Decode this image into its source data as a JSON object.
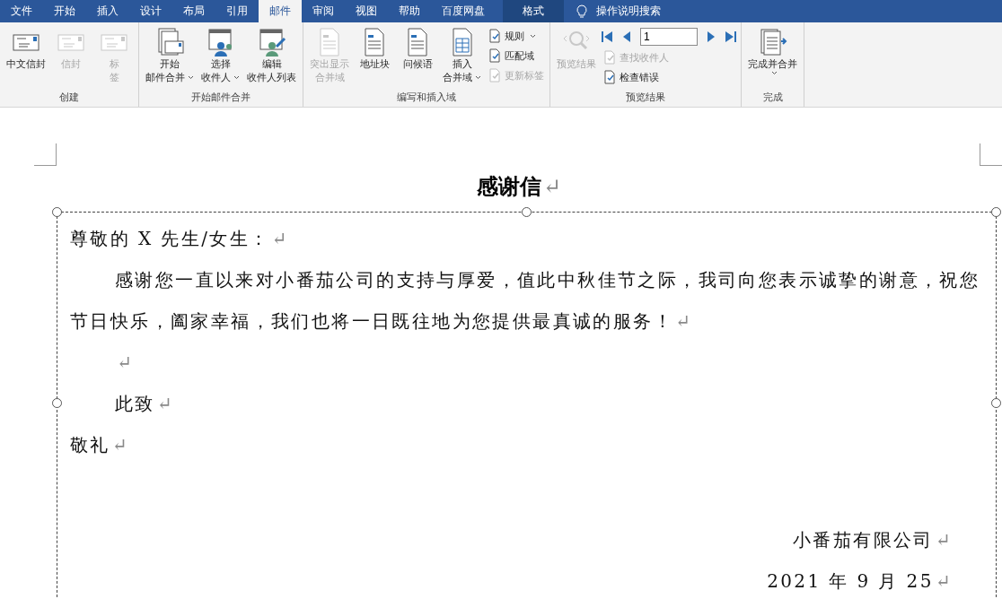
{
  "tabs": [
    {
      "label": "文件",
      "selected": false,
      "kind": "normal"
    },
    {
      "label": "开始",
      "selected": false,
      "kind": "normal"
    },
    {
      "label": "插入",
      "selected": false,
      "kind": "normal"
    },
    {
      "label": "设计",
      "selected": false,
      "kind": "normal"
    },
    {
      "label": "布局",
      "selected": false,
      "kind": "normal"
    },
    {
      "label": "引用",
      "selected": false,
      "kind": "normal"
    },
    {
      "label": "邮件",
      "selected": true,
      "kind": "normal"
    },
    {
      "label": "审阅",
      "selected": false,
      "kind": "normal"
    },
    {
      "label": "视图",
      "selected": false,
      "kind": "normal"
    },
    {
      "label": "帮助",
      "selected": false,
      "kind": "normal"
    },
    {
      "label": "百度网盘",
      "selected": false,
      "kind": "normal"
    },
    {
      "label": "格式",
      "selected": false,
      "kind": "contextual"
    }
  ],
  "search": {
    "label": "操作说明搜索"
  },
  "ribbon": [
    {
      "label": "创建",
      "items": [
        {
          "kind": "large",
          "lines": [
            "中文信封"
          ],
          "disabled": false,
          "dropdown": false
        },
        {
          "kind": "large",
          "lines": [
            "信封"
          ],
          "disabled": true,
          "dropdown": false
        },
        {
          "kind": "large",
          "lines": [
            "标",
            "签"
          ],
          "disabled": true,
          "dropdown": false
        }
      ]
    },
    {
      "label": "开始邮件合并",
      "items": [
        {
          "kind": "large",
          "lines": [
            "开始",
            "邮件合并"
          ],
          "disabled": false,
          "dropdown": true
        },
        {
          "kind": "large",
          "lines": [
            "选择",
            "收件人"
          ],
          "disabled": false,
          "dropdown": true
        },
        {
          "kind": "large",
          "lines": [
            "编辑",
            "收件人列表"
          ],
          "disabled": false,
          "dropdown": false
        }
      ]
    },
    {
      "label": "编写和插入域",
      "items": [
        {
          "kind": "large",
          "lines": [
            "突出显示",
            "合并域"
          ],
          "disabled": true,
          "dropdown": false
        },
        {
          "kind": "large",
          "lines": [
            "地址块"
          ],
          "disabled": false,
          "dropdown": false
        },
        {
          "kind": "large",
          "lines": [
            "问候语"
          ],
          "disabled": false,
          "dropdown": false
        },
        {
          "kind": "large",
          "lines": [
            "插入",
            "合并域"
          ],
          "disabled": false,
          "dropdown": true
        },
        {
          "kind": "stack",
          "items": [
            {
              "kind": "small",
              "label": "规则",
              "disabled": false,
              "dropdown": true
            },
            {
              "kind": "small",
              "label": "匹配域",
              "disabled": false,
              "dropdown": false
            },
            {
              "kind": "small",
              "label": "更新标签",
              "disabled": true,
              "dropdown": false
            }
          ]
        }
      ]
    },
    {
      "label": "预览结果",
      "items": [
        {
          "kind": "large",
          "lines": [
            "预览结果"
          ],
          "disabled": true,
          "dropdown": false
        },
        {
          "kind": "stack",
          "items": [
            {
              "kind": "nav",
              "value": "1"
            },
            {
              "kind": "small",
              "label": "查找收件人",
              "disabled": true,
              "dropdown": false
            },
            {
              "kind": "small",
              "label": "检查错误",
              "disabled": false,
              "dropdown": false
            }
          ]
        }
      ]
    },
    {
      "label": "完成",
      "items": [
        {
          "kind": "large",
          "lines": [
            "完成并合并"
          ],
          "disabled": false,
          "dropdown": true,
          "caret_below": true
        }
      ]
    }
  ],
  "document": {
    "title": "感谢信",
    "title_mark": "↵",
    "paragraphs": [
      {
        "kind": "left",
        "text": "尊敬的 X 先生/女生：",
        "mark": "↵"
      },
      {
        "kind": "indent",
        "text": "感谢您一直以来对小番茄公司的支持与厚爱，值此中秋佳节之际，我司向您表示诚挚的谢意，祝您节日快乐，阖家幸福，我们也将一日既往地为您提供最真诚的服务！",
        "mark": "↵"
      },
      {
        "kind": "indent",
        "mark": "↵"
      },
      {
        "kind": "indent",
        "text": "此致",
        "mark": "↵"
      },
      {
        "kind": "left",
        "text": "敬礼",
        "mark": "↵"
      },
      {
        "kind": "gap"
      },
      {
        "kind": "right",
        "text": "小番茄有限公司",
        "mark": "↵"
      },
      {
        "kind": "right",
        "text": "2021 年 9 月 25",
        "mark": "↵"
      }
    ]
  }
}
